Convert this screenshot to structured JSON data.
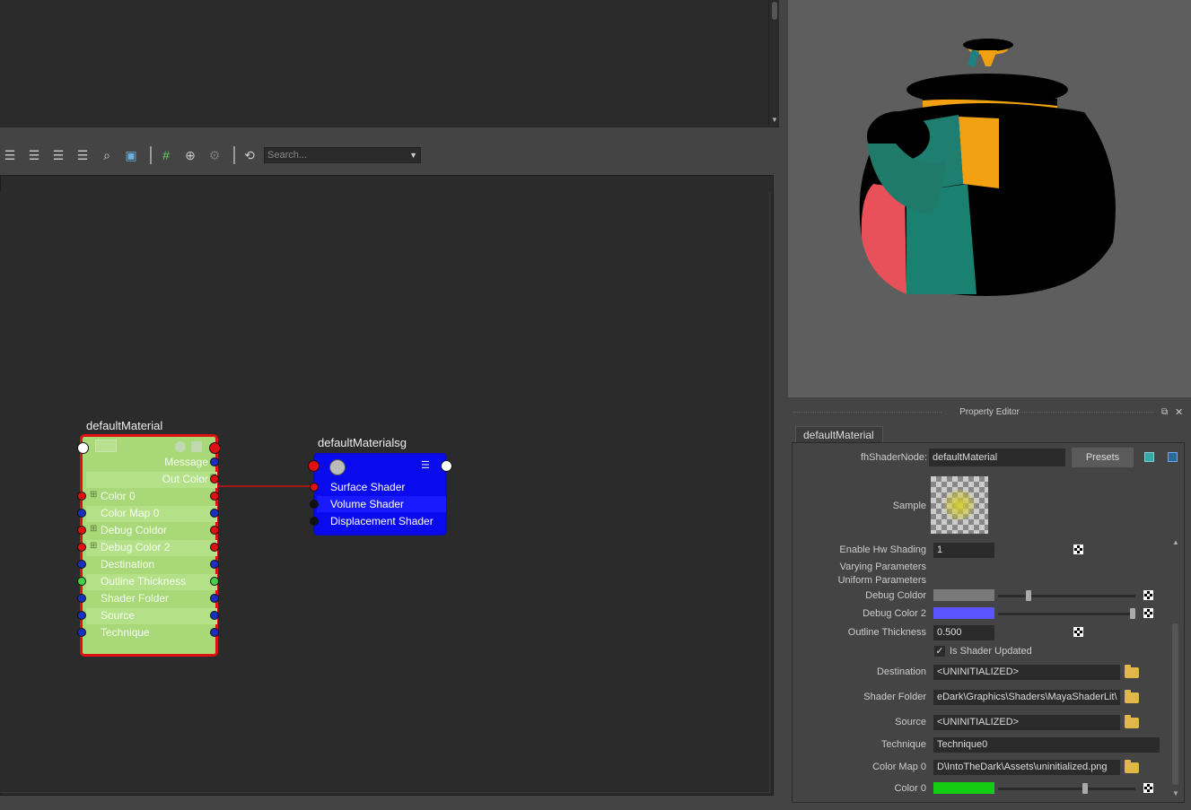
{
  "toolbar": {
    "search_placeholder": "Search...",
    "icons": [
      "layout-1-icon",
      "layout-2-icon",
      "layout-3-icon",
      "layout-4-icon",
      "search-icon",
      "graph-icon",
      "grid-icon",
      "select-icon",
      "tools-icon",
      "refresh-icon"
    ]
  },
  "graph": {
    "material_node": {
      "title": "defaultMaterial",
      "rows": [
        {
          "label": "Message",
          "align": "right",
          "left_port": "",
          "right_port": "#1a2fc0"
        },
        {
          "label": "Out Color",
          "align": "right",
          "left_port": "",
          "right_port": "#e01010",
          "expand": true
        },
        {
          "label": "Color 0",
          "align": "left",
          "left_port": "#e01010",
          "right_port": "#e01010",
          "expand": true
        },
        {
          "label": "Color Map 0",
          "align": "left",
          "left_port": "#1a2fc0",
          "right_port": "#1a2fc0"
        },
        {
          "label": "Debug Coldor",
          "align": "left",
          "left_port": "#e01010",
          "right_port": "#e01010",
          "expand": true
        },
        {
          "label": "Debug Color 2",
          "align": "left",
          "left_port": "#e01010",
          "right_port": "#e01010",
          "expand": true
        },
        {
          "label": "Destination",
          "align": "left",
          "left_port": "#1a2fc0",
          "right_port": "#1a2fc0"
        },
        {
          "label": "Outline Thickness",
          "align": "left",
          "left_port": "#44d044",
          "right_port": "#44d044"
        },
        {
          "label": "Shader Folder",
          "align": "left",
          "left_port": "#1a2fc0",
          "right_port": "#1a2fc0"
        },
        {
          "label": "Source",
          "align": "left",
          "left_port": "#1a2fc0",
          "right_port": "#1a2fc0"
        },
        {
          "label": "Technique",
          "align": "left",
          "left_port": "#1a2fc0",
          "right_port": "#1a2fc0"
        }
      ]
    },
    "sg_node": {
      "title": "defaultMaterialsg",
      "rows": [
        {
          "label": "Surface Shader",
          "port": "#e01010"
        },
        {
          "label": "Volume Shader",
          "port": "#111111"
        },
        {
          "label": "Displacement Shader",
          "port": "#111111"
        }
      ]
    }
  },
  "property_editor": {
    "title": "Property Editor",
    "tab": "defaultMaterial",
    "node_type_label": "fhShaderNode:",
    "node_name": "defaultMaterial",
    "presets_label": "Presets",
    "sample_label": "Sample",
    "enable_hw_label": "Enable Hw Shading",
    "enable_hw_value": "1",
    "varying_label": "Varying Parameters",
    "uniform_label": "Uniform Parameters",
    "debug_coldor_label": "Debug Coldor",
    "debug_coldor_color": "#7a7a7a",
    "debug_color2_label": "Debug Color 2",
    "debug_color2_color": "#5a55ff",
    "outline_label": "Outline Thickness",
    "outline_value": "0.500",
    "shader_updated_label": "Is Shader Updated",
    "shader_updated_checked": true,
    "destination_label": "Destination",
    "destination_value": "<UNINITIALIZED>",
    "shader_folder_label": "Shader Folder",
    "shader_folder_value": "eDark\\Graphics\\Shaders\\MayaShaderLit\\",
    "source_label": "Source",
    "source_value": "<UNINITIALIZED>",
    "technique_label": "Technique",
    "technique_value": "Technique0",
    "colormap_label": "Color Map 0",
    "colormap_value": "D\\IntoTheDark\\Assets\\uninitialized.png",
    "color0_label": "Color 0",
    "color0_color": "#14cc14"
  }
}
